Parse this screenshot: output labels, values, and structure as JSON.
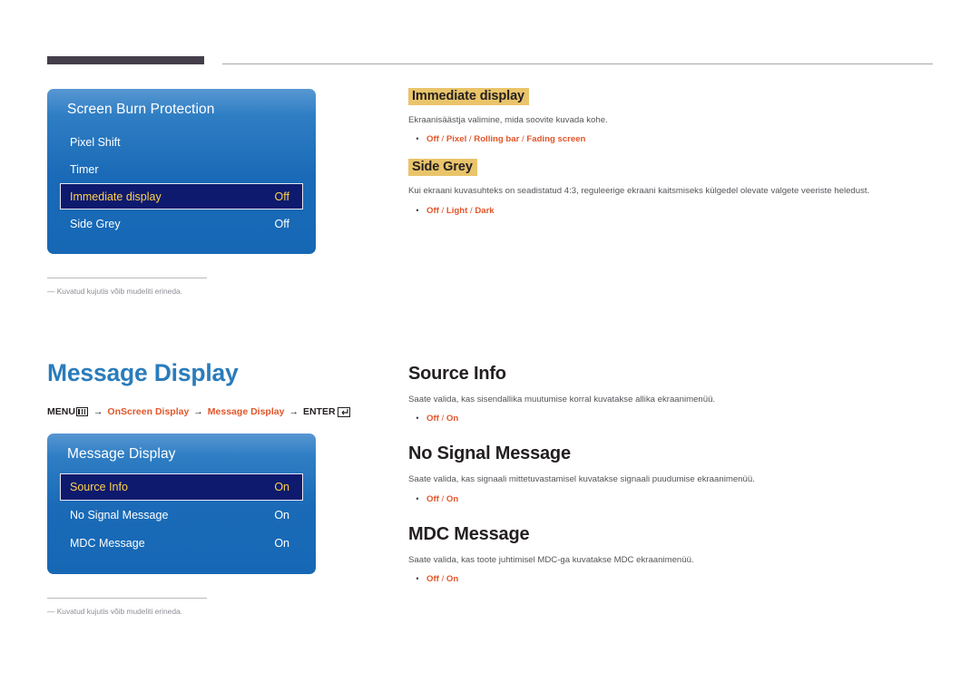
{
  "page": {
    "language_note": "Estonian user manual page",
    "footnote_text": "― Kuvatud kujutis võib mudeliti erineda."
  },
  "section_one": {
    "osd": {
      "title": "Screen Burn Protection",
      "rows": [
        {
          "label": "Pixel Shift",
          "value": "",
          "selected": false
        },
        {
          "label": "Timer",
          "value": "",
          "selected": false
        },
        {
          "label": "Immediate display",
          "value": "Off",
          "selected": true
        },
        {
          "label": "Side Grey",
          "value": "Off",
          "selected": false
        }
      ]
    },
    "footnote": "― Kuvatud kujutis võib mudeliti erineda.",
    "topics": [
      {
        "heading": "Immediate display",
        "heading_style": "highlight",
        "body": "Ekraanisäästja valimine, mida soovite kuvada kohe.",
        "options_bold": [
          "Off",
          "Pixel",
          "Rolling bar",
          "Fading screen"
        ]
      },
      {
        "heading": "Side Grey",
        "heading_style": "highlight",
        "body": "Kui ekraani kuvasuhteks on seadistatud 4:3, reguleerige ekraani kaitsmiseks külgedel olevate valgete veeriste heledust.",
        "options_bold": [
          "Off",
          "Light",
          "Dark"
        ]
      }
    ]
  },
  "section_two": {
    "title": "Message Display",
    "breadcrumb": {
      "menu_label": "MENU",
      "menu_icon": "menu-grid-icon",
      "arrow": "→",
      "step1": "OnScreen Display",
      "step2": "Message Display",
      "enter_label": "ENTER",
      "enter_icon": "enter-return-icon"
    },
    "osd": {
      "title": "Message Display",
      "rows": [
        {
          "label": "Source Info",
          "value": "On",
          "selected": true
        },
        {
          "label": "No Signal Message",
          "value": "On",
          "selected": false
        },
        {
          "label": "MDC Message",
          "value": "On",
          "selected": false
        }
      ]
    },
    "footnote": "― Kuvatud kujutis võib mudeliti erineda.",
    "topics": [
      {
        "heading": "Source Info",
        "heading_style": "plain",
        "body": "Saate valida, kas sisendallika muutumise korral kuvatakse allika ekraanimenüü.",
        "options_bold": [
          "Off",
          "On"
        ]
      },
      {
        "heading": "No Signal Message",
        "heading_style": "plain",
        "body": "Saate valida, kas signaali mittetuvastamisel kuvatakse signaali puudumise ekraanimenüü.",
        "options_bold": [
          "Off",
          "On"
        ]
      },
      {
        "heading": "MDC Message",
        "heading_style": "plain",
        "body": "Saate valida, kas toote juhtimisel MDC-ga kuvatakse MDC ekraanimenüü.",
        "options_bold": [
          "Off",
          "On"
        ]
      }
    ]
  },
  "colors": {
    "accent_blue": "#2a7cbc",
    "orange": "#e2562a",
    "highlight_yellow": "#e9c46a",
    "osd_blue": "#1a6ab7",
    "osd_selected_navy": "#0d1a6e",
    "osd_selected_text": "#ffd24a",
    "rule_dark": "#433e4a"
  }
}
